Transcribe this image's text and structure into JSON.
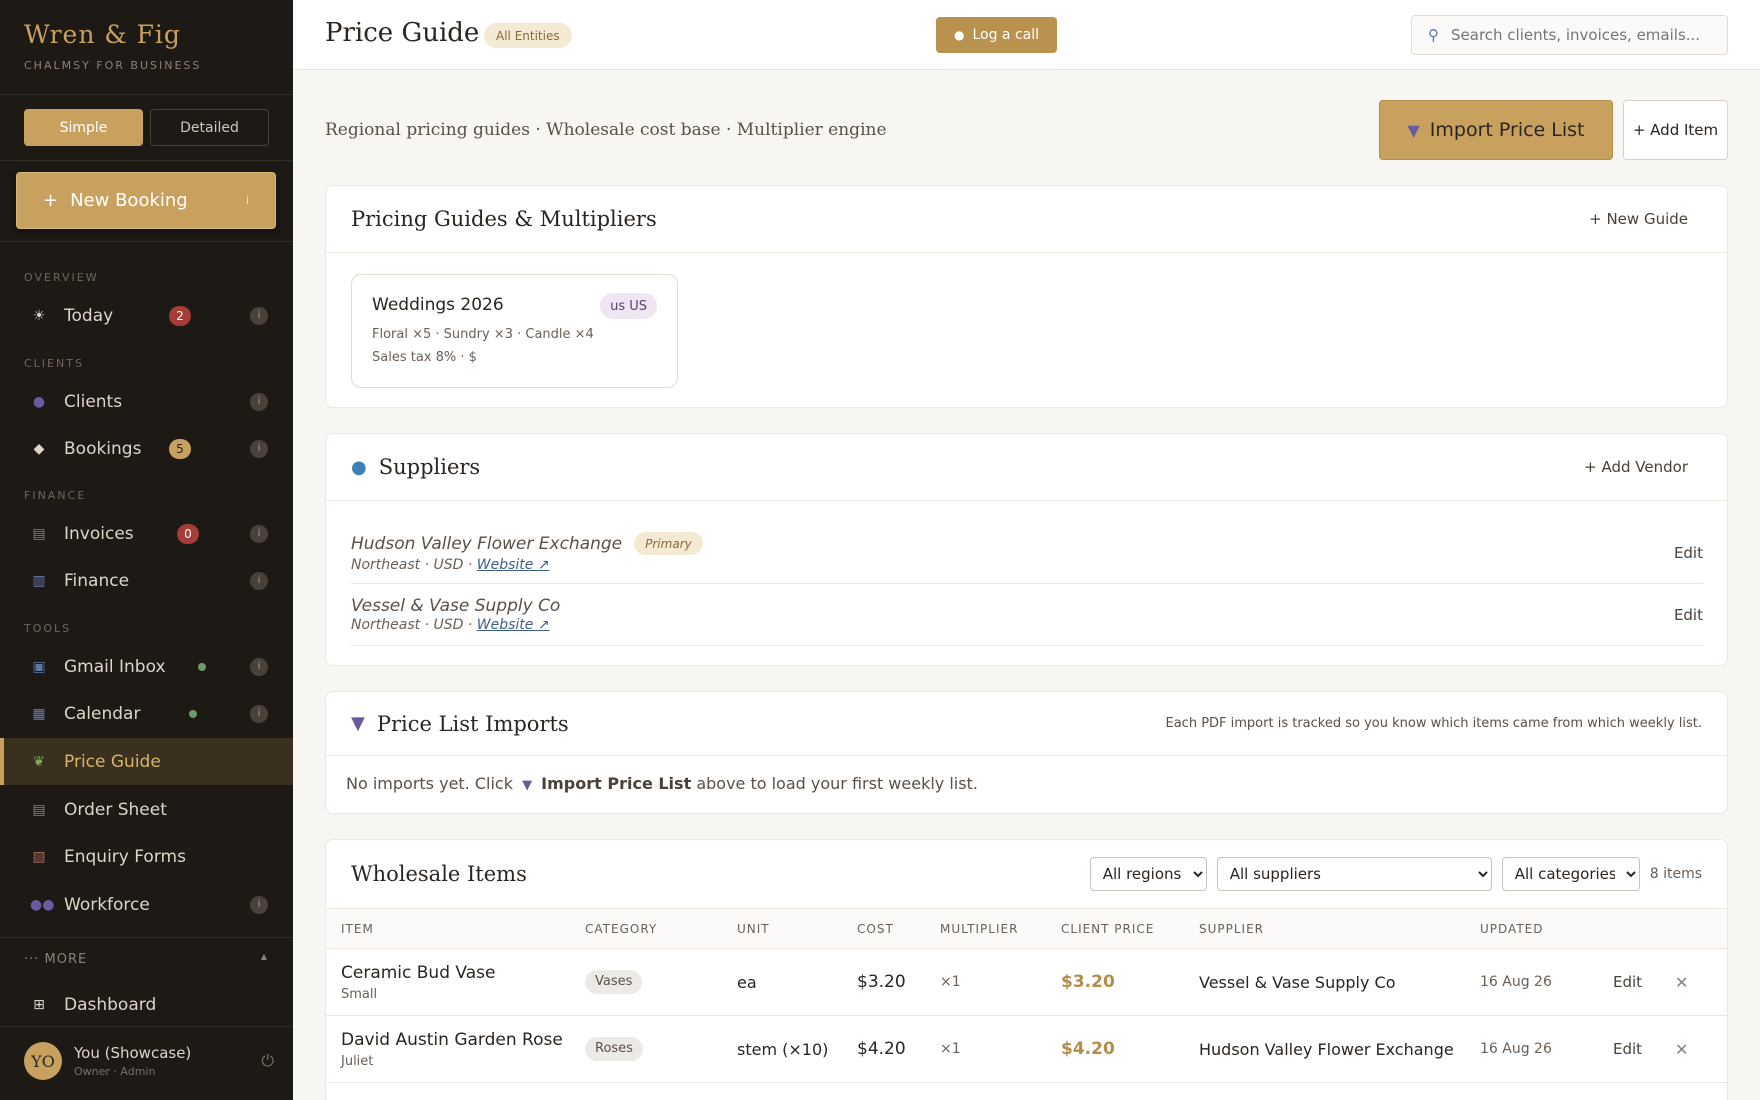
{
  "brand": {
    "name": "Wren & Fig",
    "tagline": "CHALMSY FOR BUSINESS"
  },
  "modes": {
    "simple": "Simple",
    "detailed": "Detailed"
  },
  "new_booking": {
    "label": "New Booking",
    "plus": "+",
    "info": "i"
  },
  "sidebar": {
    "sections": {
      "overview": "OVERVIEW",
      "clients": "CLIENTS",
      "finance": "FINANCE",
      "tools": "TOOLS"
    },
    "items": {
      "today": {
        "label": "Today",
        "badge": "2",
        "icon": "sun-icon"
      },
      "clients": {
        "label": "Clients",
        "icon": "person-icon"
      },
      "bookings": {
        "label": "Bookings",
        "badge": "5",
        "icon": "diamond-icon"
      },
      "invoices": {
        "label": "Invoices",
        "badge": "0",
        "icon": "receipt-icon"
      },
      "finance": {
        "label": "Finance",
        "icon": "bar-chart-icon"
      },
      "gmail": {
        "label": "Gmail Inbox",
        "icon": "mail-icon"
      },
      "calendar": {
        "label": "Calendar",
        "icon": "calendar-icon"
      },
      "price_guide": {
        "label": "Price Guide",
        "icon": "leaf-icon"
      },
      "order_sheet": {
        "label": "Order Sheet",
        "icon": "clipboard-icon"
      },
      "enquiry_forms": {
        "label": "Enquiry Forms",
        "icon": "form-icon"
      },
      "workforce": {
        "label": "Workforce",
        "icon": "people-icon"
      },
      "dashboard": {
        "label": "Dashboard",
        "icon": "grid-icon"
      }
    },
    "more": "··· MORE",
    "user": {
      "initials": "YO",
      "name": "You (Showcase)",
      "role": "Owner · Admin"
    }
  },
  "header": {
    "title": "Price Guide",
    "entity": "All Entities",
    "log_call": "Log a call",
    "search_placeholder": "Search clients, invoices, emails..."
  },
  "main": {
    "subtitle": "Regional pricing guides · Wholesale cost base · Multiplier engine",
    "import_label": "Import Price List",
    "add_item_label": "+ Add Item"
  },
  "guides": {
    "title": "Pricing Guides & Multipliers",
    "action": "+ New Guide",
    "card": {
      "name": "Weddings 2026",
      "region": "us US",
      "multipliers": "Floral ×5 · Sundry ×3 · Candle ×4",
      "tax": "Sales tax 8% · $"
    }
  },
  "suppliers": {
    "title": "Suppliers",
    "action": "+ Add Vendor",
    "rows": [
      {
        "name": "Hudson Valley Flower Exchange",
        "tag": "Primary",
        "meta": "Northeast · USD ·",
        "link": "Website ↗",
        "edit": "Edit"
      },
      {
        "name": "Vessel & Vase Supply Co",
        "meta": "Northeast · USD ·",
        "link": "Website ↗",
        "edit": "Edit"
      }
    ]
  },
  "imports": {
    "title": "Price List Imports",
    "note": "Each PDF import is tracked so you know which items came from which weekly list.",
    "empty_prefix": "No imports yet. Click",
    "empty_bold": "Import Price List",
    "empty_suffix": "above to load your first weekly list."
  },
  "wholesale": {
    "title": "Wholesale Items",
    "filters": {
      "regions": "All regions",
      "suppliers": "All suppliers",
      "categories": "All categories"
    },
    "count": "8 items",
    "columns": [
      "ITEM",
      "CATEGORY",
      "UNIT",
      "COST",
      "MULTIPLIER",
      "CLIENT PRICE",
      "SUPPLIER",
      "UPDATED"
    ],
    "rows": [
      {
        "name": "Ceramic Bud Vase",
        "sub": "Small",
        "category": "Vases",
        "unit": "ea",
        "cost": "$3.20",
        "multiplier": "×1",
        "client_price": "$3.20",
        "supplier": "Vessel & Vase Supply Co",
        "updated": "16 Aug 26",
        "edit": "Edit"
      },
      {
        "name": "David Austin Garden Rose",
        "sub": "Juliet",
        "category": "Roses",
        "unit": "stem (×10)",
        "cost": "$4.20",
        "multiplier": "×1",
        "client_price": "$4.20",
        "supplier": "Hudson Valley Flower Exchange",
        "updated": "16 Aug 26",
        "edit": "Edit"
      }
    ]
  }
}
